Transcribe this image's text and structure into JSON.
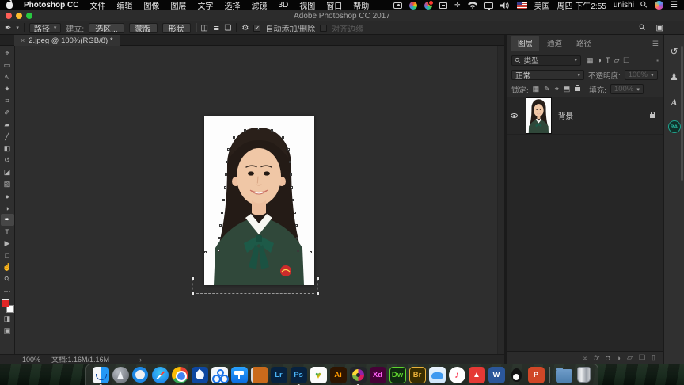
{
  "menubar": {
    "app_name": "Photoshop CC",
    "items": [
      "文件",
      "编辑",
      "图像",
      "图层",
      "文字",
      "选择",
      "滤镜",
      "3D",
      "视图",
      "窗口",
      "帮助"
    ],
    "status": {
      "region_label": "美国",
      "datetime": "周四 下午2:55",
      "username": "unishi"
    }
  },
  "window": {
    "title": "Adobe Photoshop CC 2017"
  },
  "options_bar": {
    "preset_glyph": "✒",
    "mode_value": "路径",
    "make_label": "建立:",
    "selection_button": "选区...",
    "mask_button": "蒙版",
    "shape_button": "形状",
    "path_ops_glyph": "◫",
    "align_glyph": "≣",
    "arrange_glyph": "❏",
    "gear_glyph": "⚙",
    "check_glyph": "✓",
    "auto_add_label": "自动添加/删除",
    "align_edges_label": "对齐边缘"
  },
  "document_tab": {
    "close_glyph": "×",
    "label": "2.jpeg @ 100%(RGB/8) *"
  },
  "tools": {
    "items": [
      {
        "name": "move-tool",
        "glyph": "⌖"
      },
      {
        "name": "marquee-tool",
        "glyph": "▭"
      },
      {
        "name": "lasso-tool",
        "glyph": "∿"
      },
      {
        "name": "quick-selection-tool",
        "glyph": "✦"
      },
      {
        "name": "crop-tool",
        "glyph": "⌗"
      },
      {
        "name": "eyedropper-tool",
        "glyph": "✐"
      },
      {
        "name": "healing-brush-tool",
        "glyph": "▰"
      },
      {
        "name": "brush-tool",
        "glyph": "╱"
      },
      {
        "name": "clone-stamp-tool",
        "glyph": "◧"
      },
      {
        "name": "history-brush-tool",
        "glyph": "↺"
      },
      {
        "name": "eraser-tool",
        "glyph": "◪"
      },
      {
        "name": "gradient-tool",
        "glyph": "▨"
      },
      {
        "name": "blur-tool",
        "glyph": "●"
      },
      {
        "name": "dodge-tool",
        "glyph": "◑"
      },
      {
        "name": "pen-tool",
        "glyph": "✒"
      },
      {
        "name": "type-tool",
        "glyph": "T"
      },
      {
        "name": "path-selection-tool",
        "glyph": "▶"
      },
      {
        "name": "shape-tool",
        "glyph": "□"
      },
      {
        "name": "hand-tool",
        "glyph": "☝"
      },
      {
        "name": "zoom-tool",
        "glyph": "⚲"
      },
      {
        "name": "edit-toolbar",
        "glyph": "⋯"
      },
      {
        "name": "quick-mask",
        "glyph": "◨"
      },
      {
        "name": "screen-mode",
        "glyph": "▣"
      }
    ],
    "foreground_color": "#e02525",
    "background_color": "#fdfdfd"
  },
  "layers_panel": {
    "tabs": [
      "图层",
      "通道",
      "路径"
    ],
    "menu_glyph": "☰",
    "filter": {
      "search_glyph": "⚲",
      "label": "类型",
      "caret": "▾"
    },
    "filter_icons": [
      {
        "name": "pixel-filter-icon",
        "glyph": "▦"
      },
      {
        "name": "adjustment-filter-icon",
        "glyph": "◑"
      },
      {
        "name": "type-filter-icon",
        "glyph": "T"
      },
      {
        "name": "shape-filter-icon",
        "glyph": "▱"
      },
      {
        "name": "smart-object-filter-icon",
        "glyph": "❏"
      }
    ],
    "pin_glyph": "▪",
    "blend_mode": "正常",
    "opacity_label": "不透明度:",
    "opacity_value": "100%",
    "lock_label": "锁定:",
    "lock_icons": [
      {
        "name": "lock-transparency-icon",
        "glyph": "▦"
      },
      {
        "name": "lock-paint-icon",
        "glyph": "✎"
      },
      {
        "name": "lock-position-icon",
        "glyph": "⌖"
      },
      {
        "name": "lock-artboard-icon",
        "glyph": "⬒"
      }
    ],
    "fill_label": "填充:",
    "fill_value": "100%",
    "layer": {
      "name": "背景"
    },
    "bottom_icons": [
      {
        "name": "link-layers-icon",
        "glyph": "∞"
      },
      {
        "name": "layer-effects-icon",
        "glyph": "fx"
      },
      {
        "name": "layer-mask-icon",
        "glyph": "◘"
      },
      {
        "name": "adjustment-layer-icon",
        "glyph": "◑"
      },
      {
        "name": "layer-group-icon",
        "glyph": "▱"
      },
      {
        "name": "new-layer-icon",
        "glyph": "❏"
      },
      {
        "name": "delete-layer-icon",
        "glyph": "▯"
      }
    ]
  },
  "side_dock": {
    "history_glyph": "↺",
    "clone_glyph": "♟",
    "character_glyph": "A",
    "avatar_initials": "RA"
  },
  "status_bar": {
    "zoom": "100%",
    "doc_info": "文档:1.16M/1.16M",
    "chevron": "›"
  },
  "dock": {
    "items": [
      {
        "name": "finder"
      },
      {
        "name": "launchpad"
      },
      {
        "name": "quicktime"
      },
      {
        "name": "safari"
      },
      {
        "name": "chrome"
      },
      {
        "name": "browser-bird-app"
      },
      {
        "name": "circles-app"
      },
      {
        "name": "keynote"
      },
      {
        "name": "notebook-app"
      },
      {
        "name": "lightroom",
        "label": "Lr",
        "style": "background:#07223f;color:#4ab4f4"
      },
      {
        "name": "photoshop",
        "label": "Ps",
        "style": "background:#07223f;color:#4ab4f4"
      },
      {
        "name": "heart-app",
        "glyph": "♥"
      },
      {
        "name": "illustrator",
        "label": "Ai",
        "style": "background:#2e1500;color:#ff9a00"
      },
      {
        "name": "film-app"
      },
      {
        "name": "adobe-xd",
        "label": "Xd",
        "style": "background:#470137;color:#ff61f6"
      },
      {
        "name": "dreamweaver",
        "label": "Dw",
        "style": "background:#0f2b10;color:#5fd32e;border:1px solid #5fd32e"
      },
      {
        "name": "bridge",
        "label": "Br",
        "style": "background:#3a2e00;color:#e8b13a;border:1px solid #e8b13a"
      },
      {
        "name": "cloud-drive-app"
      },
      {
        "name": "music-app",
        "glyph": "♪"
      },
      {
        "name": "red-a-app",
        "glyph": "▲"
      },
      {
        "name": "word",
        "label": "W",
        "style": "background:#2b579a;color:#ffffff"
      },
      {
        "name": "qq"
      },
      {
        "name": "powerpoint",
        "label": "P",
        "style": "background:#d04727;color:#ffffff"
      },
      {
        "name": "downloads-folder"
      },
      {
        "name": "trash"
      }
    ]
  }
}
